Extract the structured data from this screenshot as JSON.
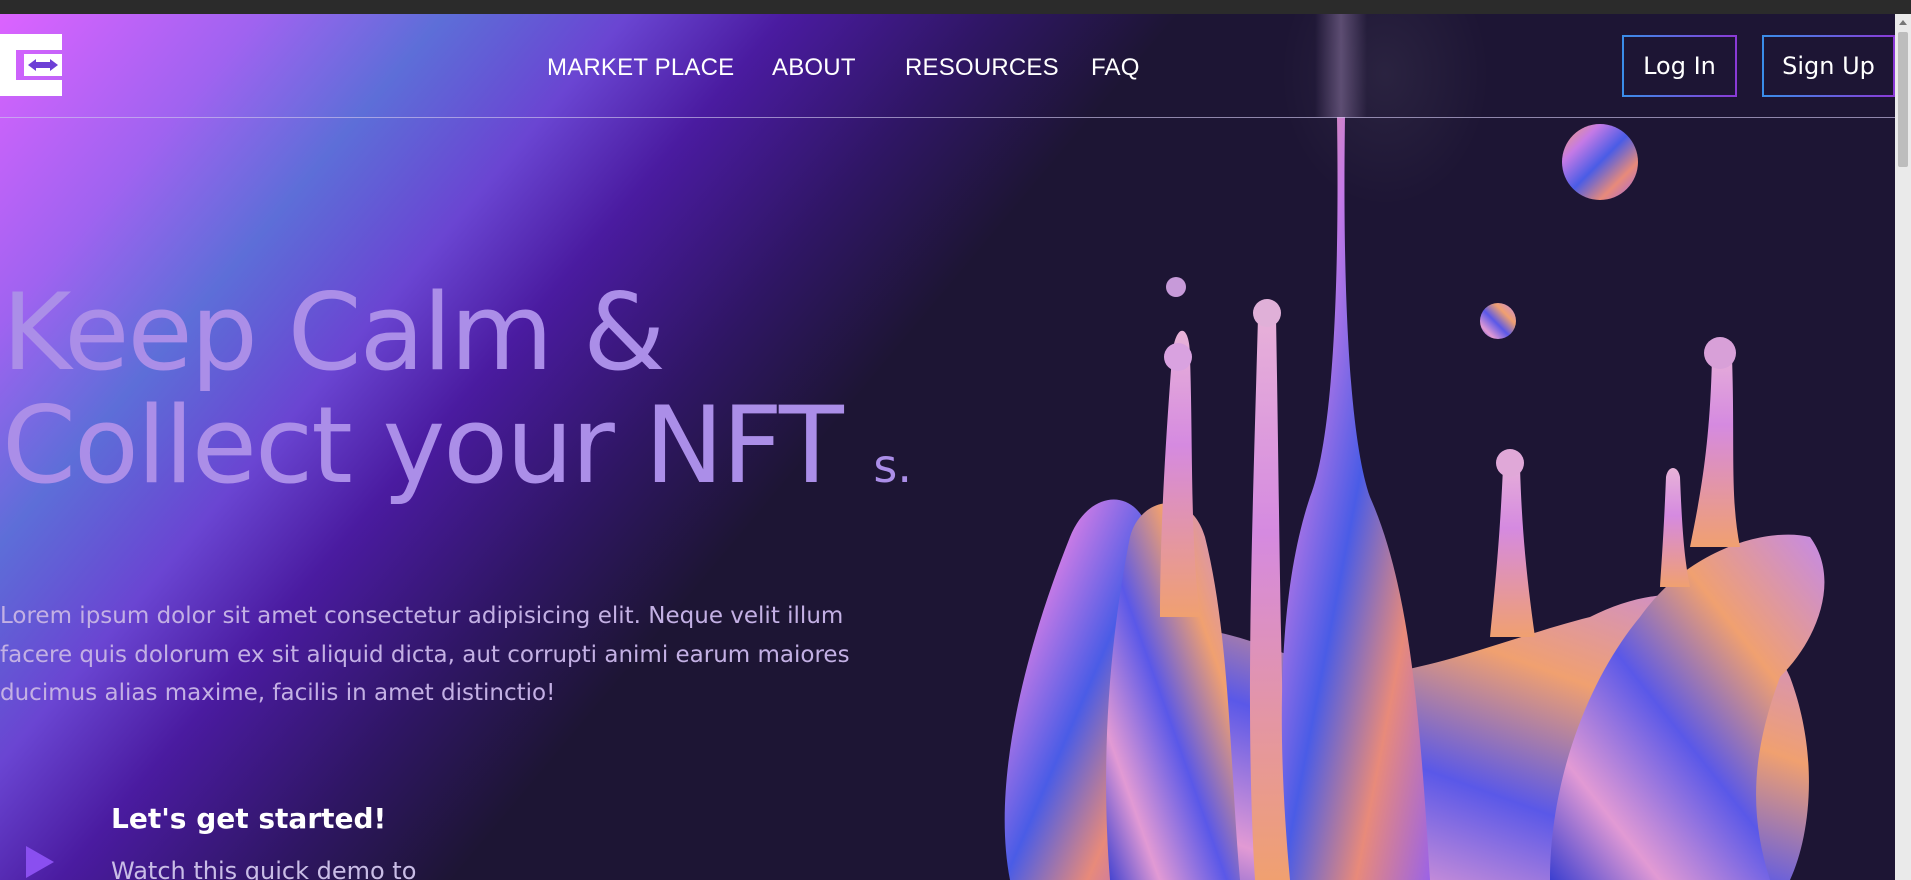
{
  "nav": {
    "links": [
      "MARKET PLACE",
      "ABOUT",
      "RESOURCES",
      "FAQ"
    ],
    "login_label": "Log In",
    "signup_label": "Sign Up"
  },
  "hero": {
    "title_line1": "Keep Calm &",
    "title_line2": "Collect your NFT",
    "title_suffix": "s.",
    "description": "Lorem ipsum dolor sit amet consectetur adipisicing elit. Neque velit illum facere quis dolorum ex sit aliquid dicta, aut corrupti animi earum maiores ducimus alias maxime, facilis in amet distinctio!",
    "cta_heading": "Let's get started!",
    "cta_text": "Watch this quick demo to"
  },
  "icons": {
    "logo": "logo-icon",
    "play": "play-icon"
  },
  "colors": {
    "background": "#1d1534",
    "hero_title": "#ab8ee8",
    "accent_purple": "#8a4ff0",
    "button_border_start": "#3a8de8",
    "button_border_end": "#8a3ad6"
  }
}
